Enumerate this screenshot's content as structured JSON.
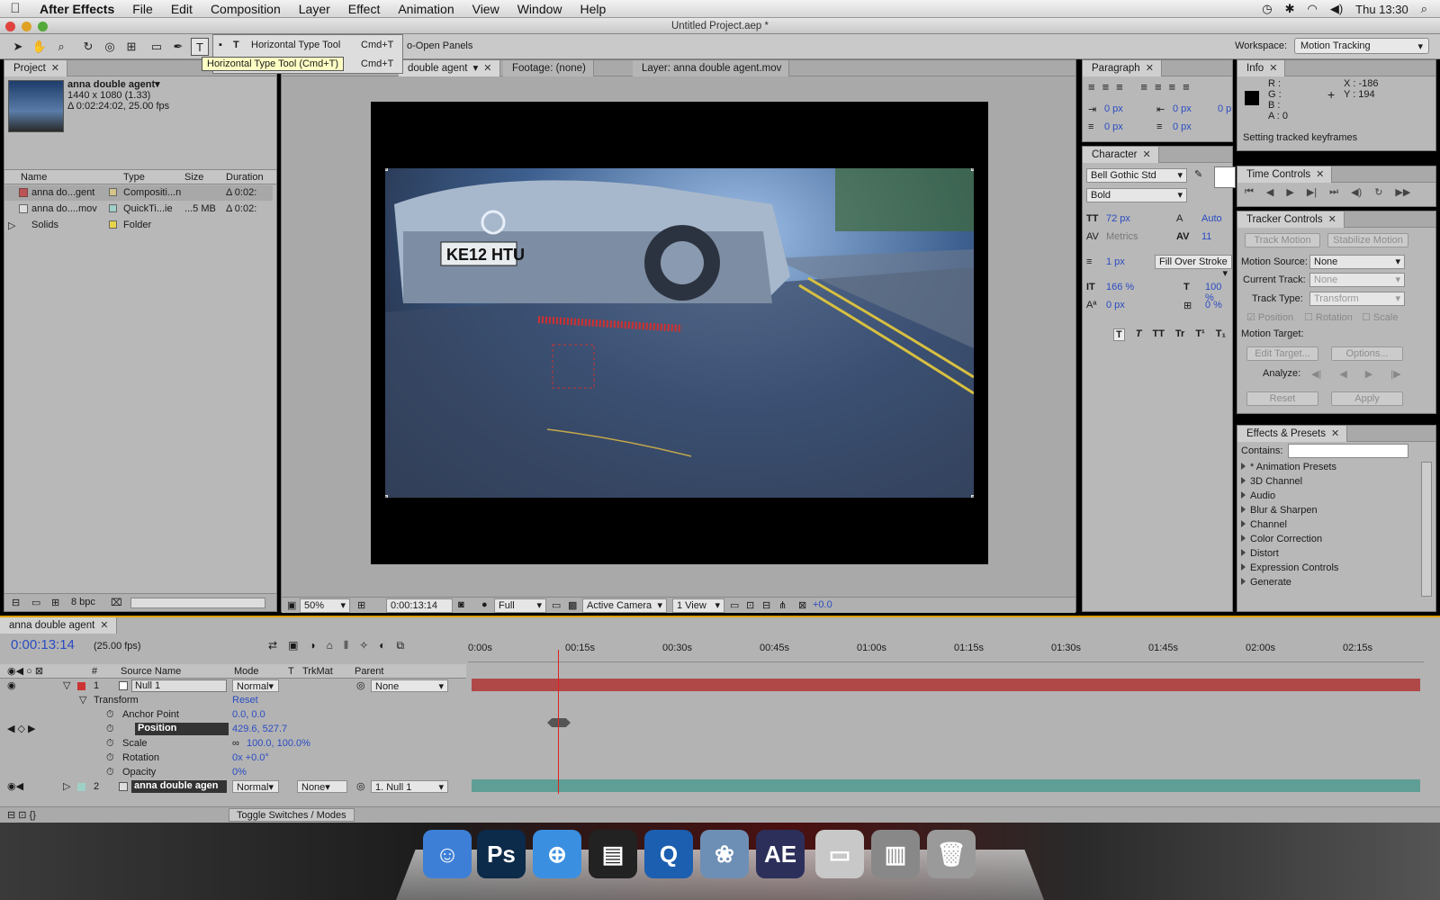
{
  "menubar": {
    "app": "After Effects",
    "items": [
      "File",
      "Edit",
      "Composition",
      "Layer",
      "Effect",
      "Animation",
      "View",
      "Window",
      "Help"
    ],
    "clock": "Thu 13:30"
  },
  "window": {
    "title": "Untitled Project.aep *"
  },
  "toolbar": {
    "workspace_label": "Workspace:",
    "workspace_value": "Motion Tracking",
    "open_panels": "o-Open Panels",
    "tool_menu": [
      {
        "name": "Horizontal Type Tool",
        "shortcut": "Cmd+T"
      },
      {
        "name": "",
        "shortcut": "Cmd+T"
      }
    ],
    "tooltip": "Horizontal Type Tool (Cmd+T)"
  },
  "project": {
    "tab": "Project",
    "item_name": "anna double agent▾",
    "item_size": "1440 x 1080 (1.33)",
    "item_duration": "Δ 0:02:24:02, 25.00 fps",
    "columns": [
      "Name",
      "Type",
      "Size",
      "Duration"
    ],
    "rows": [
      {
        "name": "anna do...gent",
        "type": "Compositi...n",
        "size": "",
        "duration": "Δ 0:02:",
        "color": "#d4c48a"
      },
      {
        "name": "anna do....mov",
        "type": "QuickTi...ie",
        "size": "...5 MB",
        "duration": "Δ 0:02:",
        "color": "#9fd0c7"
      },
      {
        "name": "Solids",
        "type": "Folder",
        "size": "",
        "duration": "",
        "color": "#e8d44a"
      }
    ],
    "bpc": "8 bpc"
  },
  "viewer": {
    "tabs": [
      "double agent",
      "Footage: (none)",
      "Layer: anna double agent.mov"
    ],
    "zoom": "50%",
    "timecode": "0:00:13:14",
    "resolution": "Full",
    "camera": "Active Camera",
    "views": "1 View",
    "exposure": "+0.0",
    "plate": "KE12 HTU"
  },
  "paragraph": {
    "tab": "Paragraph",
    "fields": [
      "0 px",
      "0 px",
      "0 p",
      "0 px",
      "0 px"
    ]
  },
  "character": {
    "tab": "Character",
    "font": "Bell Gothic Std",
    "style": "Bold",
    "size": "72 px",
    "leading": "Auto",
    "kerning": "Metrics",
    "tracking": "11",
    "stroke": "1 px",
    "stroke_mode": "Fill Over Stroke",
    "vscale": "166 %",
    "hscale": "100 %",
    "baseline": "0 px",
    "tsume": "0 %",
    "px_suffix": "px",
    "style_buttons": [
      "T",
      "T",
      "TT",
      "Tr",
      "T¹",
      "T₁"
    ]
  },
  "info": {
    "tab": "Info",
    "labels": [
      "R :",
      "G :",
      "B :",
      "A : 0"
    ],
    "x": "X : -186",
    "y": "Y : 194",
    "message": "Setting tracked keyframes"
  },
  "time_controls": {
    "tab": "Time Controls"
  },
  "tracker": {
    "tab": "Tracker Controls",
    "track_motion": "Track Motion",
    "stabilize": "Stabilize Motion",
    "source_label": "Motion Source:",
    "source_value": "None",
    "current_label": "Current Track:",
    "current_value": "None",
    "type_label": "Track Type:",
    "type_value": "Transform",
    "checks": [
      "Position",
      "Rotation",
      "Scale"
    ],
    "target_label": "Motion Target:",
    "edit_target": "Edit Target...",
    "options": "Options...",
    "analyze": "Analyze:",
    "reset": "Reset",
    "apply": "Apply"
  },
  "effects": {
    "tab": "Effects & Presets",
    "contains": "Contains:",
    "items": [
      "* Animation Presets",
      "3D Channel",
      "Audio",
      "Blur & Sharpen",
      "Channel",
      "Color Correction",
      "Distort",
      "Expression Controls",
      "Generate"
    ]
  },
  "timeline": {
    "tab": "anna double agent",
    "timecode": "0:00:13:14",
    "fps": "(25.00 fps)",
    "col_num": "#",
    "col_source": "Source Name",
    "col_mode": "Mode",
    "col_t": "T",
    "col_trkmat": "TrkMat",
    "col_parent": "Parent",
    "ruler": [
      "0:00s",
      "00:15s",
      "00:30s",
      "00:45s",
      "01:00s",
      "01:15s",
      "01:30s",
      "01:45s",
      "02:00s",
      "02:15s"
    ],
    "layer1": {
      "num": "1",
      "name": "Null 1",
      "mode": "Normal",
      "parent": "None"
    },
    "transform": "Transform",
    "reset": "Reset",
    "props": [
      {
        "name": "Anchor Point",
        "value": "0.0, 0.0"
      },
      {
        "name": "Position",
        "value": "429.6, 527.7"
      },
      {
        "name": "Scale",
        "value": "100.0, 100.0%"
      },
      {
        "name": "Rotation",
        "value": "0x +0.0°"
      },
      {
        "name": "Opacity",
        "value": "0%"
      }
    ],
    "layer2": {
      "num": "2",
      "name": "anna double agen",
      "mode": "Normal",
      "trkmat": "None",
      "parent": "1. Null 1"
    },
    "toggle": "Toggle Switches / Modes",
    "playhead_fraction": 0.094
  },
  "dock": {
    "apps": [
      {
        "name": "Finder",
        "glyph": "☺",
        "color": "#3d7fd6"
      },
      {
        "name": "Photoshop",
        "glyph": "Ps",
        "color": "#0c2a4a"
      },
      {
        "name": "Safari",
        "glyph": "⊕",
        "color": "#3a8fe0"
      },
      {
        "name": "Final Cut",
        "glyph": "▤",
        "color": "#222"
      },
      {
        "name": "QuickTime",
        "glyph": "Q",
        "color": "#1c5fb0"
      },
      {
        "name": "iPhoto",
        "glyph": "❀",
        "color": "#6d8fb5"
      },
      {
        "name": "After Effects",
        "glyph": "AE",
        "color": "#2c2f5a"
      },
      {
        "name": "Preview",
        "glyph": "▭",
        "color": "#c8c8c8"
      },
      {
        "name": "Documents",
        "glyph": "▥",
        "color": "#888"
      },
      {
        "name": "Trash",
        "glyph": "🗑",
        "color": "#9a9a9a"
      }
    ]
  }
}
